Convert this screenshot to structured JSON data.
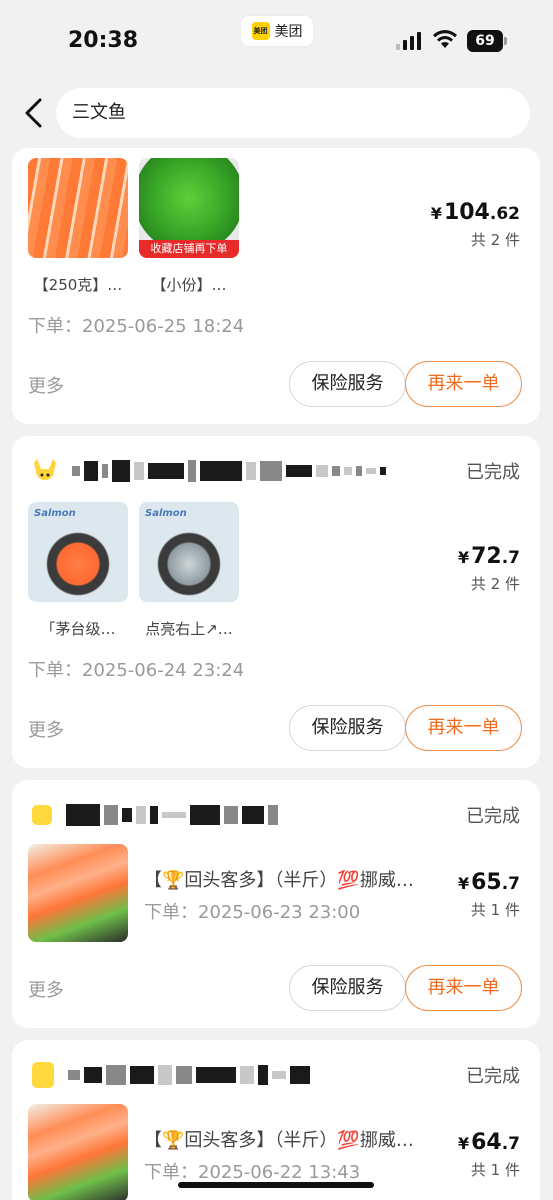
{
  "status": {
    "time": "20:38",
    "app_badge": "美团",
    "logo_text": "美团",
    "battery": "69"
  },
  "search": {
    "query": "三文鱼"
  },
  "orders": [
    {
      "status": "",
      "items": [
        {
          "caption": "【250克】…",
          "image": "salmon-slices"
        },
        {
          "caption": "【小份】…",
          "image": "seaweed-salad",
          "banner": "收藏店铺再下单"
        }
      ],
      "price_currency": "¥",
      "price_int": "104",
      "price_dec": ".62",
      "count": "共 2 件",
      "order_time": "下单：2025-06-25 18:24",
      "more": "更多",
      "insurance_btn": "保险服务",
      "reorder_btn": "再来一单"
    },
    {
      "status": "已完成",
      "items": [
        {
          "caption": "「茅台级…",
          "image": "salmon-bowl",
          "brand": "Salmon"
        },
        {
          "caption": "点亮右上↗…",
          "image": "shrimp-bowl",
          "brand": "Salmon"
        }
      ],
      "price_currency": "¥",
      "price_int": "72",
      "price_dec": ".7",
      "count": "共 2 件",
      "order_time": "下单：2025-06-24 23:24",
      "more": "更多",
      "insurance_btn": "保险服务",
      "reorder_btn": "再来一单"
    },
    {
      "status": "已完成",
      "title": "【🏆回头客多】（半斤）💯挪威…",
      "price_currency": "¥",
      "price_int": "65",
      "price_dec": ".7",
      "count": "共 1 件",
      "order_time": "下单：2025-06-23 23:00",
      "more": "更多",
      "insurance_btn": "保险服务",
      "reorder_btn": "再来一单"
    },
    {
      "status": "已完成",
      "title": "【🏆回头客多】（半斤）💯挪威…",
      "price_currency": "¥",
      "price_int": "64",
      "price_dec": ".7",
      "count": "共 1 件",
      "order_time": "下单：2025-06-22 13:43"
    }
  ],
  "colors": {
    "accent": "#f06b1e",
    "brand_yellow": "#ffd100",
    "background": "#f1f1f1"
  }
}
